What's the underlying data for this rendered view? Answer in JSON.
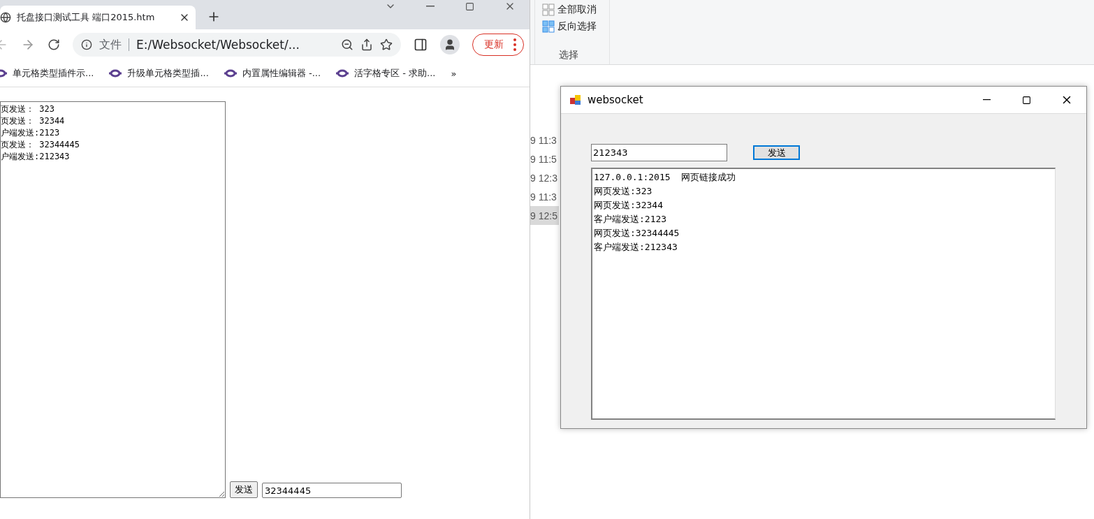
{
  "browser": {
    "tab": {
      "title": "托盘接口测试工具 端口2015.htm",
      "selected": true
    },
    "address": {
      "security_label": "文件",
      "url": "E:/Websocket/Websocket/..."
    },
    "update_button": "更新",
    "bookmarks": [
      {
        "label": "单元格类型插件示..."
      },
      {
        "label": "升级单元格类型插..."
      },
      {
        "label": "内置属性编辑器 -..."
      },
      {
        "label": "活字格专区 - 求助..."
      }
    ],
    "bookmarks_overflow": "»",
    "page": {
      "log_lines": [
        "页发送： 323",
        "页发送： 32344",
        "户端发送:2123",
        "页发送： 32344445",
        "户端发送:212343"
      ],
      "send_button": "发送",
      "message_input": "32344445"
    }
  },
  "explorer": {
    "ribbon_commands": [
      {
        "label": "全部取消",
        "kind": "select-none"
      },
      {
        "label": "反向选择",
        "kind": "invert"
      }
    ],
    "group_label": "选择",
    "file_rows": [
      {
        "modified": "9 11:3",
        "selected": false
      },
      {
        "modified": "9 11:5",
        "selected": false
      },
      {
        "modified": "9 12:3",
        "selected": false
      },
      {
        "modified": "9 11:3",
        "selected": false
      },
      {
        "modified": "9 12:5",
        "selected": true
      }
    ]
  },
  "websocket_window": {
    "title": "websocket",
    "message_input": "212343",
    "send_button": "发送",
    "log_lines": [
      "127.0.0.1:2015  网页链接成功",
      "网页发送:323",
      "网页发送:32344",
      "客户端发送:2123",
      "网页发送:32344445",
      "客户端发送:212343"
    ]
  }
}
